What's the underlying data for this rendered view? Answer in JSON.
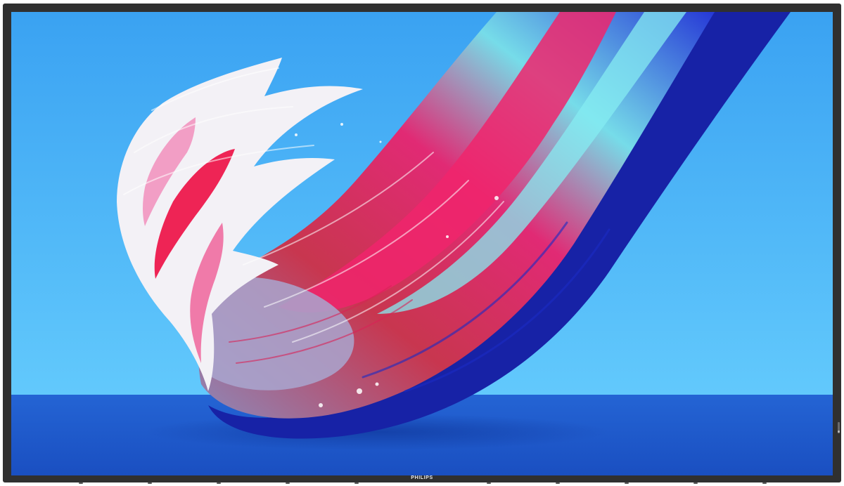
{
  "image": {
    "subject": "philips-display-with-paint-stroke-wallpaper",
    "brand": "PHILIPS",
    "colors": {
      "bezel": "#303030",
      "sky_top": "#3aa6f4",
      "sky_bottom": "#5ec6fb",
      "floor": "#1c55c9",
      "stroke_blue": "#1d2fd2",
      "stroke_pink": "#f0266a",
      "stroke_cyan": "#7fe6f0",
      "stroke_white": "#f4f2f7"
    }
  }
}
